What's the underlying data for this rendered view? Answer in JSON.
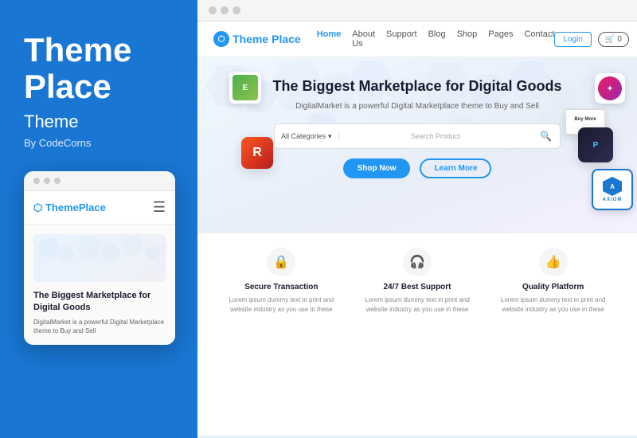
{
  "left_panel": {
    "title_line1": "Theme",
    "title_line2": "Place",
    "subtitle": "Theme",
    "author": "By CodeCorns",
    "mobile_preview": {
      "logo_text": "Theme",
      "logo_accent": "Place",
      "heading": "The Biggest Marketplace for Digital Goods",
      "subtext": "DigitalMarket is a powerful Digital Marketplace theme to Buy and Sell"
    }
  },
  "right_panel": {
    "nav": {
      "logo_text": "Theme",
      "logo_accent": "Place",
      "links": [
        "Home",
        "About Us",
        "Support",
        "Blog",
        "Shop",
        "Pages",
        "Contact"
      ],
      "active_link": "Home",
      "login_label": "Login",
      "cart_count": "0"
    },
    "hero": {
      "title": "The Biggest Marketplace for Digital Goods",
      "subtitle": "DigitalMarket is a powerful Digital Marketplace theme to Buy and Sell",
      "search_placeholder": "Search Product",
      "search_category": "All Categories",
      "btn_shop": "Shop Now",
      "btn_learn": "Learn More"
    },
    "features": [
      {
        "icon": "🔒",
        "title": "Secure Transaction",
        "text": "Lorem ipsum dummy text in print and website industry as you use in these"
      },
      {
        "icon": "🎧",
        "title": "24/7 Best Support",
        "text": "Lorem ipsum dummy text in print and website industry as you use in these"
      },
      {
        "icon": "👍",
        "title": "Quality Platform",
        "text": "Lorem ipsum dummy text in print and website industry as you use in these"
      }
    ]
  },
  "colors": {
    "primary": "#2196F3",
    "dark_bg": "#1976D2",
    "text_dark": "#1a1a2e"
  }
}
